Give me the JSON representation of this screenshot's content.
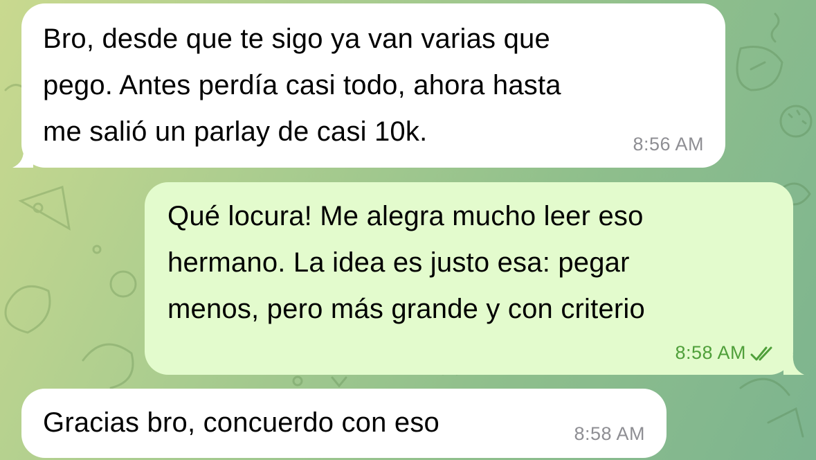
{
  "messages": [
    {
      "direction": "incoming",
      "text": "Bro, desde que te sigo ya van varias que\npego. Antes perdía casi todo, ahora hasta\nme salió un parlay de casi 10k.",
      "time": "8:56 AM"
    },
    {
      "direction": "outgoing",
      "text": "Qué locura! Me alegra mucho leer eso\nhermano. La idea es justo esa: pegar\nmenos, pero más grande y con criterio",
      "time": "8:58 AM",
      "status": "read-double-check-icon"
    },
    {
      "direction": "incoming",
      "text": "Gracias bro, concuerdo con eso",
      "time": "8:58 AM"
    }
  ],
  "colors": {
    "incoming_bubble": "#ffffff",
    "outgoing_bubble": "#e3fbcd",
    "outgoing_meta": "#4f9f3a",
    "incoming_meta": "#8e8e93"
  }
}
